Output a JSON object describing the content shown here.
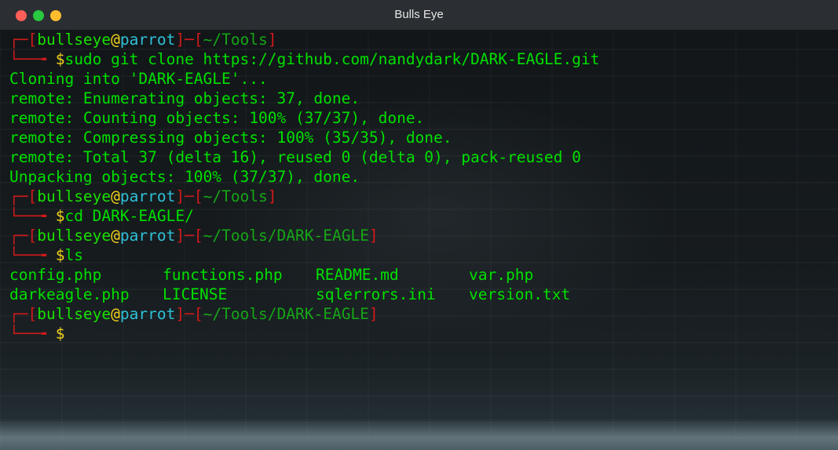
{
  "window": {
    "title": "Bulls Eye"
  },
  "prompts": [
    {
      "user": "bullseye",
      "at": "@",
      "host": "parrot",
      "path": "~/Tools",
      "dollar": "$",
      "cmd": "sudo git clone https://github.com/nandydark/DARK-EAGLE.git"
    },
    {
      "user": "bullseye",
      "at": "@",
      "host": "parrot",
      "path": "~/Tools",
      "dollar": "$",
      "cmd": "cd DARK-EAGLE/"
    },
    {
      "user": "bullseye",
      "at": "@",
      "host": "parrot",
      "path": "~/Tools/DARK-EAGLE",
      "dollar": "$",
      "cmd": "ls"
    },
    {
      "user": "bullseye",
      "at": "@",
      "host": "parrot",
      "path": "~/Tools/DARK-EAGLE",
      "dollar": "$",
      "cmd": ""
    }
  ],
  "clone_output": [
    "Cloning into 'DARK-EAGLE'...",
    "remote: Enumerating objects: 37, done.",
    "remote: Counting objects: 100% (37/37), done.",
    "remote: Compressing objects: 100% (35/35), done.",
    "remote: Total 37 (delta 16), reused 0 (delta 0), pack-reused 0",
    "Unpacking objects: 100% (37/37), done."
  ],
  "ls_output": {
    "row1": [
      "config.php",
      "functions.php",
      "README.md",
      "var.php"
    ],
    "row2": [
      "darkeagle.php",
      "LICENSE",
      "sqlerrors.ini",
      "version.txt"
    ]
  }
}
